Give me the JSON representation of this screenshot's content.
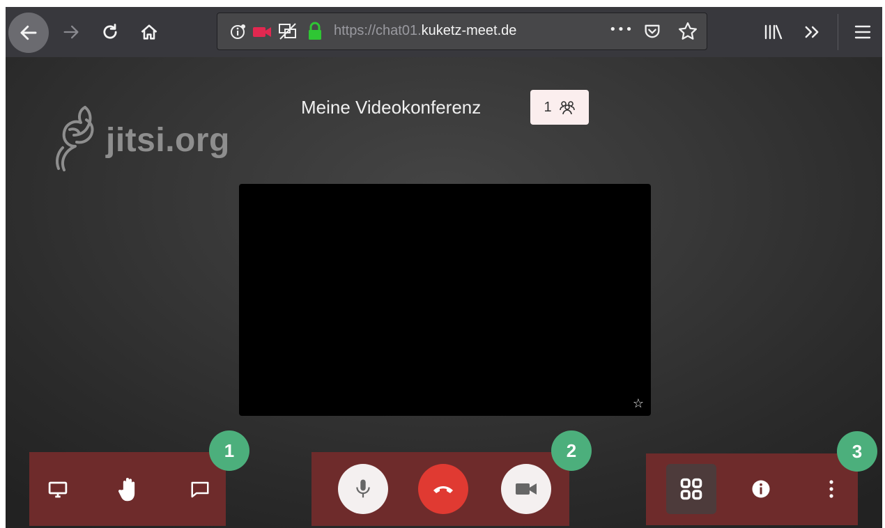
{
  "browser": {
    "url_prefix": "https://chat01.",
    "url_domain": "kuketz-meet.de",
    "page_actions_label": "•••"
  },
  "meeting": {
    "room_name": "Meine Videokonferenz",
    "participant_count": "1",
    "logo_text": "jitsi.org"
  },
  "toolbox": {
    "badges": [
      "1",
      "2",
      "3"
    ],
    "hangup_color": "#e03a32",
    "group_color": "#6e2b2b",
    "badge_color": "#4caf7c"
  }
}
